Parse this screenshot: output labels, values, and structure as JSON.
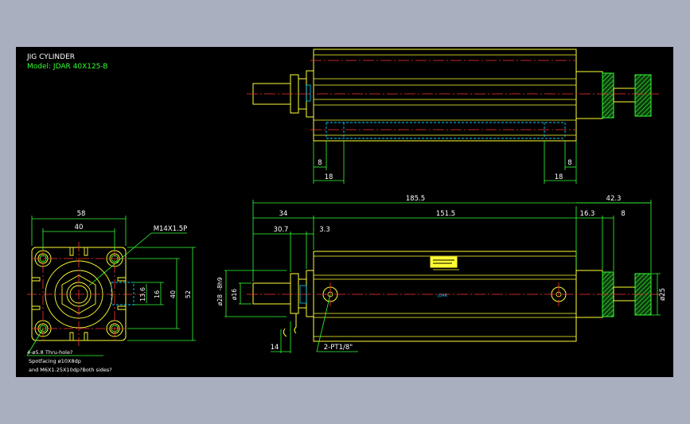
{
  "title": {
    "line1": "JIG CYLINDER",
    "line2": "Model: JDAR 40X125-B"
  },
  "top_view_dims": {
    "d_left_8": "8",
    "d_left_18": "18",
    "d_right_8": "8",
    "d_right_18": "18"
  },
  "side_view_dims": {
    "d_185_5": "185.5",
    "d_42_3": "42.3",
    "d_34": "34",
    "d_151_5": "151.5",
    "d_16_3": "16.3",
    "d_8": "8",
    "d_30_7": "30.7",
    "d_3_3": "3.3",
    "d_phi28": "ø28",
    "d_h8": "-8h9",
    "d_phi16": "ø16",
    "d_phi25": "ø25",
    "d_14": "14",
    "port_label": "2-PT1/8\""
  },
  "end_view_dims": {
    "d_58": "58",
    "d_40_top": "40",
    "thread": "M14X1.5P",
    "d_13_6": "13.6",
    "d_16": "16",
    "d_40_side": "40",
    "d_52": "52",
    "note1": "4-ø5.8  Thru-hole?",
    "note2": "Spotfacing  ø10X8dp",
    "note3": "and M6X1.25X10dp?Both sides?"
  },
  "colors": {
    "background": "#000000",
    "body": "#ffff33",
    "dimension": "#33ff33",
    "centerline": "#ff3333",
    "hidden": "#00ccff",
    "hatch": "#22cc22",
    "frame": "#a9afbf"
  }
}
